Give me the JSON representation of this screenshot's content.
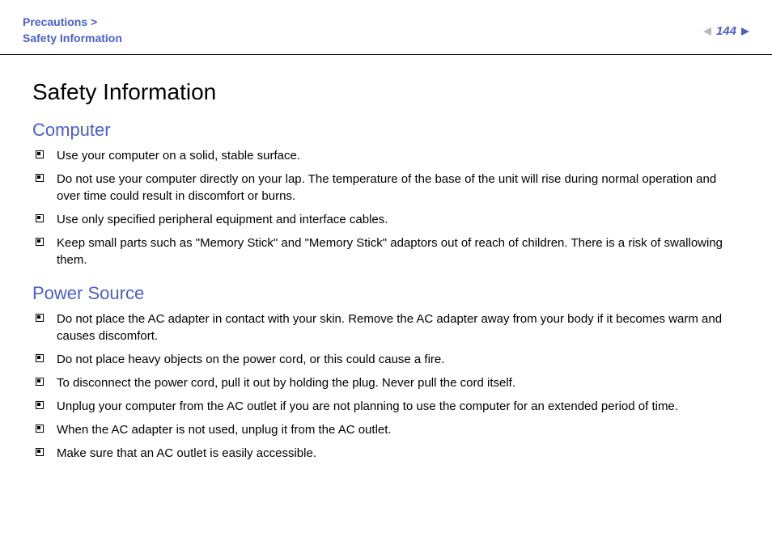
{
  "header": {
    "breadcrumb_line1": "Precautions >",
    "breadcrumb_line2": "Safety Information",
    "page_number": "144"
  },
  "main": {
    "title": "Safety Information",
    "sections": [
      {
        "heading": "Computer",
        "items": [
          "Use your computer on a solid, stable surface.",
          "Do not use your computer directly on your lap. The temperature of the base of the unit will rise during normal operation and over time could result in discomfort or burns.",
          "Use only specified peripheral equipment and interface cables.",
          "Keep small parts such as \"Memory Stick\" and \"Memory Stick\" adaptors out of reach of children. There is a risk of swallowing them."
        ]
      },
      {
        "heading": "Power Source",
        "items": [
          "Do not place the AC adapter in contact with your skin. Remove the AC adapter away from your body if it becomes warm and causes discomfort.",
          "Do not place heavy objects on the power cord, or this could cause a fire.",
          "To disconnect the power cord, pull it out by holding the plug. Never pull the cord itself.",
          "Unplug your computer from the AC outlet if you are not planning to use the computer for an extended period of time.",
          "When the AC adapter is not used, unplug it from the AC outlet.",
          "Make sure that an AC outlet is easily accessible."
        ]
      }
    ]
  }
}
